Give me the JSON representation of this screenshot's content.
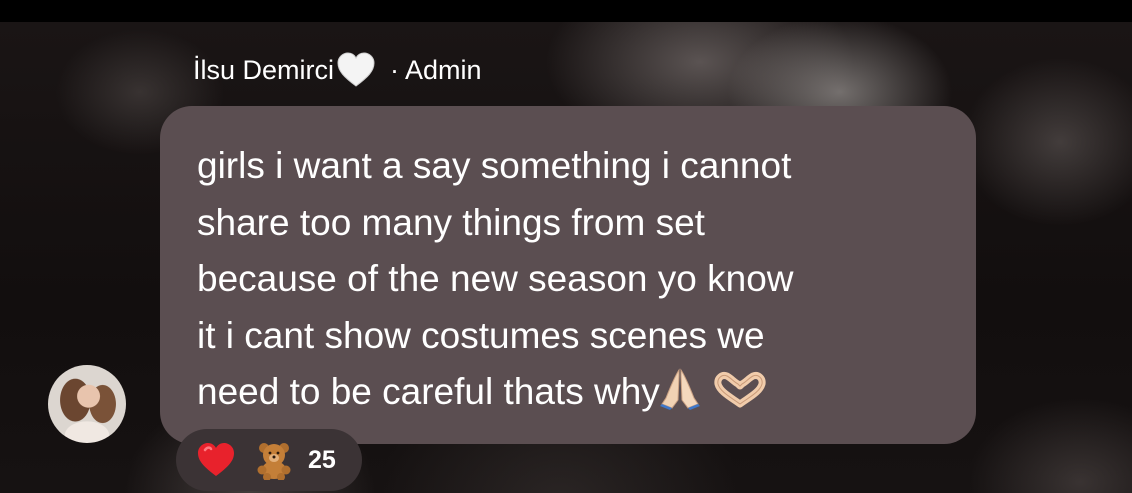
{
  "message": {
    "sender_name": "İlsu Demirci",
    "sender_heart_icon": "white-heart-emoji",
    "sender_role": "· Admin",
    "text": "girls i want a say something i cannot\nshare too many things from set\nbecause of the new season yo know\nit i cant show costumes scenes we\nneed to be careful thats why",
    "trailing_emojis": [
      "folded-hands-emoji",
      "heart-hands-emoji"
    ]
  },
  "reactions": {
    "items": [
      "red-heart-emoji",
      "teddy-bear-emoji"
    ],
    "count": "25"
  },
  "colors": {
    "bubble": "#5b4e51",
    "reaction_pill": "#3b3335",
    "text": "#ffffff"
  }
}
